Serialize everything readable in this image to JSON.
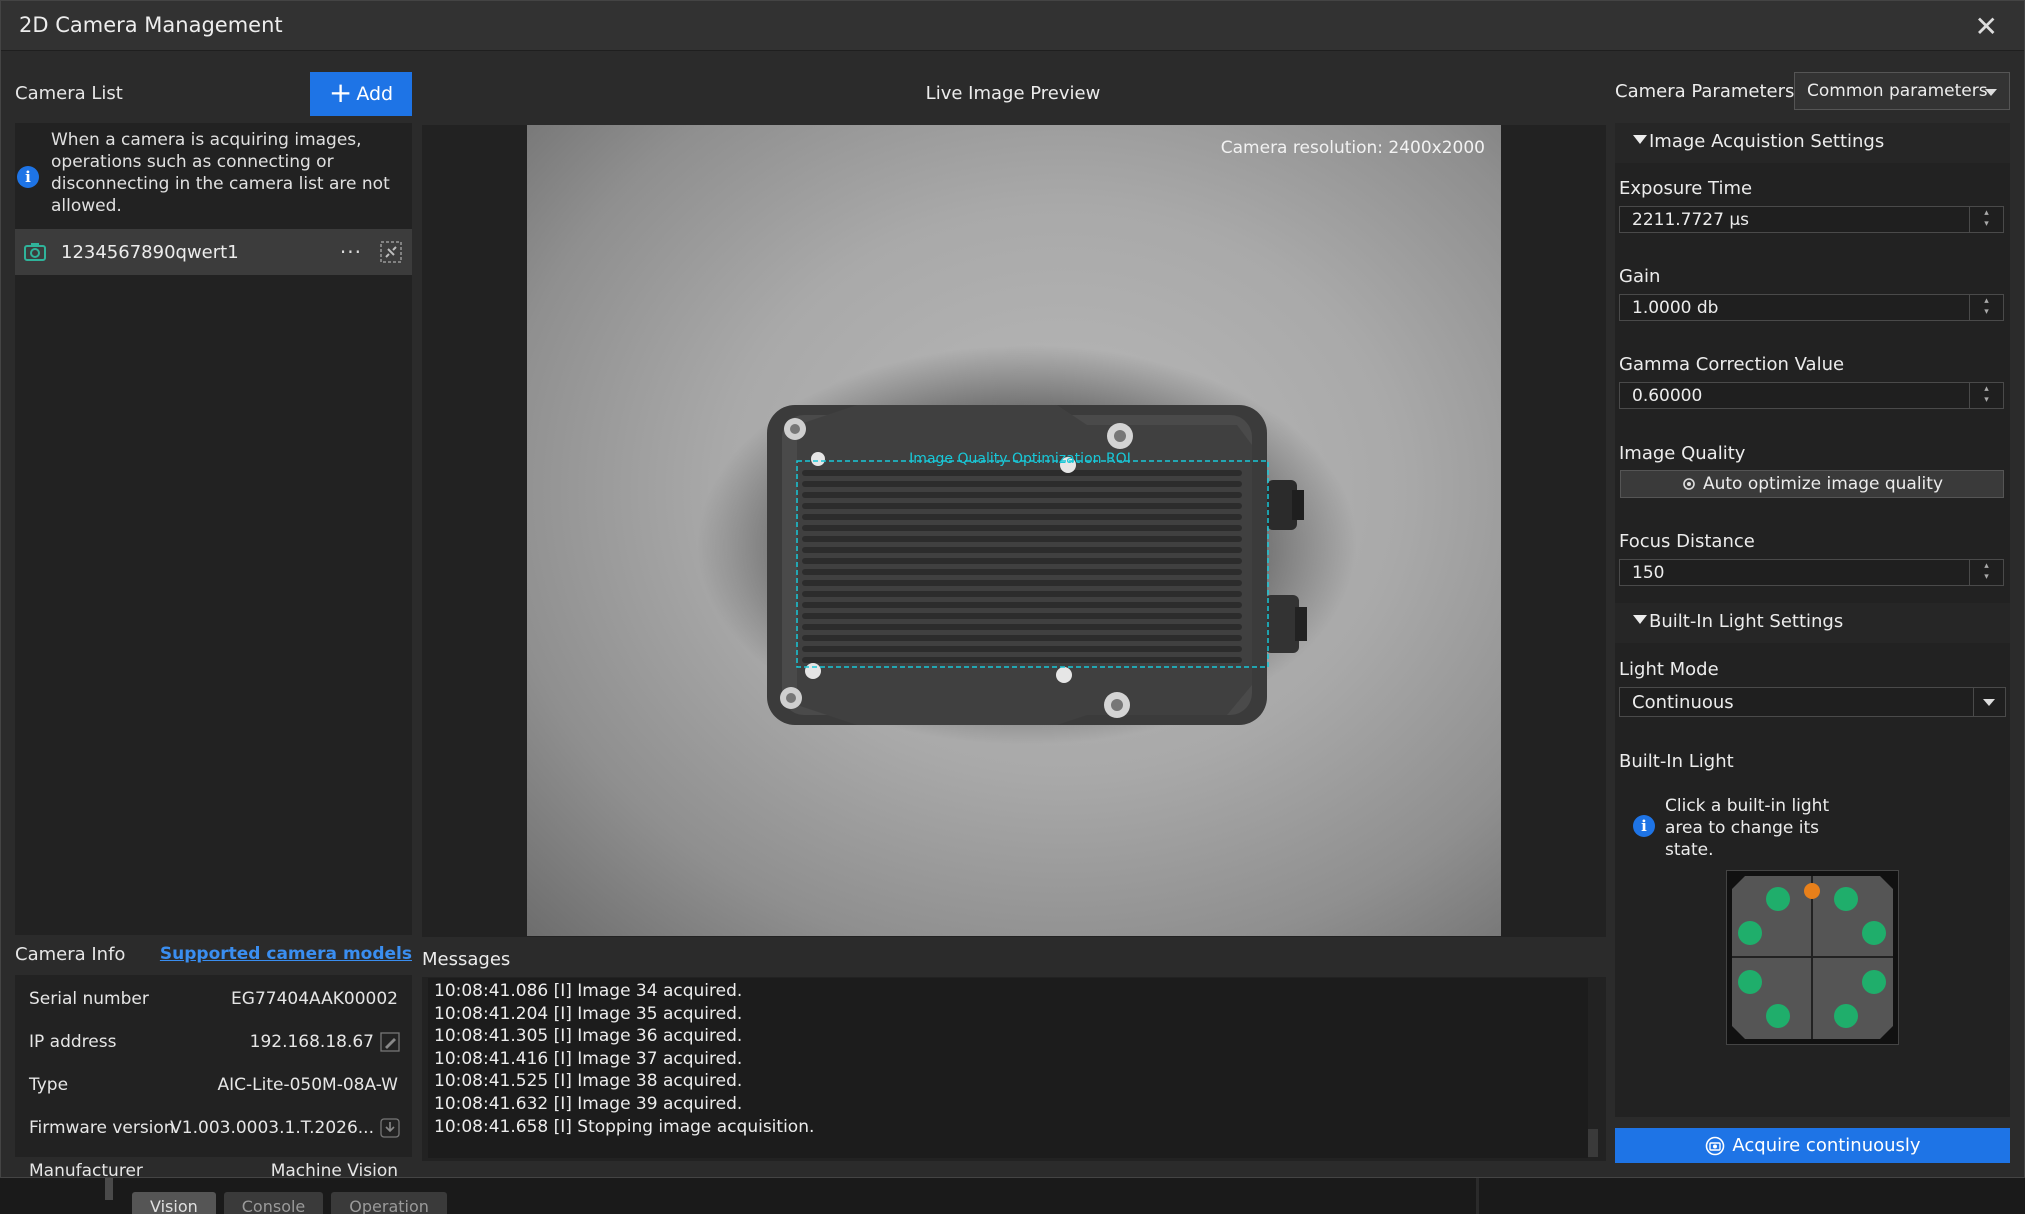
{
  "window": {
    "title": "2D Camera Management",
    "close_glyph": "✕"
  },
  "camera_list": {
    "label": "Camera List",
    "add_label": "Add",
    "note": "When a camera is acquiring images, operations connecting or disconnecting in the camera list are not allowed.",
    "note_text": "When a camera is acquiring images, operations such as connecting or disconnecting in the camera list are not allowed.",
    "items": [
      {
        "name": "1234567890qwert1",
        "more": "···"
      }
    ]
  },
  "camera_info": {
    "label": "Camera Info",
    "link": "Supported camera models",
    "rows": [
      {
        "key": "Serial number",
        "value": "EG77404AAK00002"
      },
      {
        "key": "IP address",
        "value": "192.168.18.67"
      },
      {
        "key": "Type",
        "value": "AIC-Lite-050M-08A-W"
      },
      {
        "key": "Firmware version",
        "value": "V1.003.0003.1.T.2026..."
      },
      {
        "key": "Manufacturer",
        "value": "Machine Vision"
      }
    ]
  },
  "preview": {
    "title": "Live Image Preview",
    "resolution": "Camera resolution: 2400x2000",
    "roi_label": "Image Quality Optimization ROI"
  },
  "messages": {
    "label": "Messages",
    "lines": [
      "10:08:41.086 [I] Image 34 acquired.",
      "10:08:41.204 [I] Image 35 acquired.",
      "10:08:41.305 [I] Image 36 acquired.",
      "10:08:41.416 [I] Image 37 acquired.",
      "10:08:41.525 [I] Image 38 acquired.",
      "10:08:41.632 [I] Image 39 acquired.",
      "10:08:41.658 [I] Stopping image acquisition."
    ]
  },
  "params": {
    "label": "Camera Parameters",
    "mode": "Common parameters",
    "acquisition_group": "Image Acquistion Settings",
    "exposure_label": "Exposure Time",
    "exposure_value": "2211.7727 μs",
    "gain_label": "Gain",
    "gain_value": "1.0000 db",
    "gamma_label": "Gamma Correction Value",
    "gamma_value": "0.60000",
    "quality_label": "Image Quality",
    "quality_button": "Auto optimize image quality",
    "focus_label": "Focus Distance",
    "focus_value": "150",
    "light_group": "Built-In Light Settings",
    "light_mode_label": "Light Mode",
    "light_mode_value": "Continuous",
    "builtin_light_label": "Built-In Light",
    "builtin_light_note": "Click a built-in light area to change its state.",
    "light_colors": {
      "on": "#1fae6b",
      "indicator": "#e8801a"
    }
  },
  "acquire": {
    "label": "Acquire continuously"
  },
  "background_tabs": [
    "Vision",
    "Console",
    "Operation"
  ]
}
